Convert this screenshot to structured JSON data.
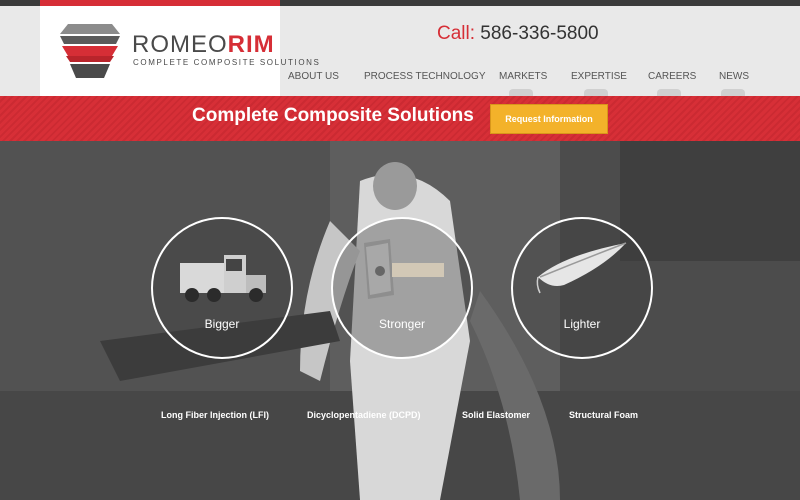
{
  "brand": {
    "name_part1": "ROMEO",
    "name_part2": "RIM",
    "tagline": "COMPLETE COMPOSITE SOLUTIONS",
    "accent_color": "#d62e36",
    "logo_icon": "stacked-hexagon-logo-icon"
  },
  "contact": {
    "call_label": "Call:",
    "phone": "586-336-5800"
  },
  "nav": {
    "items": [
      {
        "label": "ABOUT US"
      },
      {
        "label": "PROCESS TECHNOLOGY"
      },
      {
        "label": "MARKETS"
      },
      {
        "label": "EXPERTISE"
      },
      {
        "label": "CAREERS"
      },
      {
        "label": "NEWS"
      }
    ]
  },
  "banner": {
    "title": "Complete Composite Solutions",
    "button_label": "Request Information",
    "button_color": "#f3b22a"
  },
  "features": [
    {
      "label": "Bigger",
      "icon": "semi-truck-icon"
    },
    {
      "label": "Stronger",
      "icon": "sledgehammer-icon"
    },
    {
      "label": "Lighter",
      "icon": "feather-icon"
    }
  ],
  "processes": [
    {
      "label": "Long Fiber Injection (LFI)"
    },
    {
      "label": "Dicyclopentadiene (DCPD)"
    },
    {
      "label": "Solid Elastomer"
    },
    {
      "label": "Structural Foam"
    }
  ]
}
